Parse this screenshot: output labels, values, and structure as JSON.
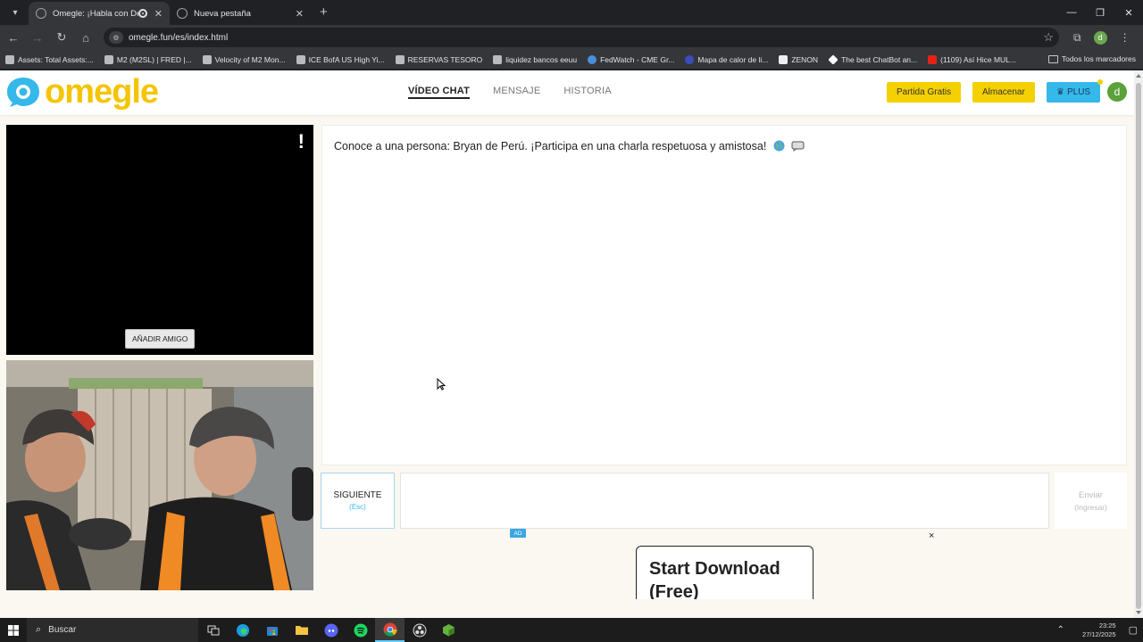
{
  "browser": {
    "tabs": [
      {
        "title": "Omegle: ¡Habla con Descon",
        "active": true
      },
      {
        "title": "Nueva pestaña",
        "active": false
      }
    ],
    "url": "omegle.fun/es/index.html",
    "bookmarks": [
      "Assets: Total Assets:...",
      "M2 (M2SL) | FRED |...",
      "Velocity of M2 Mon...",
      "ICE BofA US High Yi...",
      "RESERVAS TESORO",
      "liquidez bancos eeuu",
      "FedWatch - CME Gr...",
      "Mapa de calor de li...",
      "ZENON",
      "The best ChatBot an...",
      "(1109) Así Hice MUL..."
    ],
    "all_bookmarks": "Todos los marcadores",
    "profile_initial": "d"
  },
  "site": {
    "logo": "omegle",
    "nav": {
      "video": "VÍDEO CHAT",
      "message": "MENSAJE",
      "history": "HISTORIA"
    },
    "buttons": {
      "free_game": "Partida Gratis",
      "store": "Almacenar",
      "plus": "PLUS"
    },
    "user_initial": "d"
  },
  "video": {
    "report_flag": "!",
    "add_friend": "AÑADIR AMIGO"
  },
  "chat": {
    "message": "Conoce a una persona: Bryan de Perú. ¡Participa en una charla respetuosa y amistosa!"
  },
  "controls": {
    "next_label": "SIGUIENTE",
    "next_key": "(Esc)",
    "send_label": "Enviar",
    "send_key": "(Ingresar)"
  },
  "ad": {
    "badge": "AD",
    "close": "×",
    "cta": "Start Download (Free)"
  },
  "taskbar": {
    "search": "Buscar",
    "time": "23:25",
    "date": "27/12/2025"
  }
}
